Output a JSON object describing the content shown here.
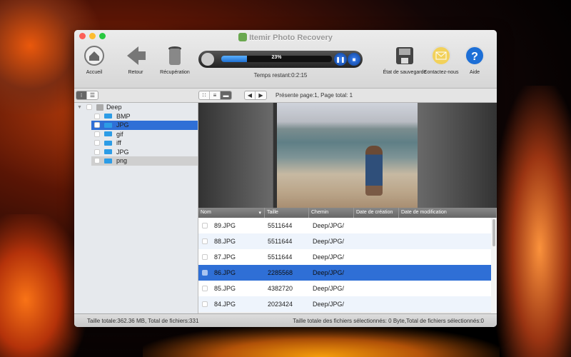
{
  "app": {
    "title": "Itemir Photo Recovery"
  },
  "toolbar": {
    "home": "Accueil",
    "back": "Retour",
    "recover": "Récupération",
    "save_state": "État de sauvegarde",
    "contact": "Contactez-nous",
    "help": "Aide"
  },
  "progress": {
    "percent_label": "23%",
    "percent": 23,
    "time_remaining": "Temps restant:0:2:15"
  },
  "pager": {
    "text": "Présente page:1,  Page total: 1"
  },
  "tree": {
    "root": "Deep",
    "items": [
      {
        "label": "BMP"
      },
      {
        "label": "JPG",
        "selected": true
      },
      {
        "label": "gif"
      },
      {
        "label": "iff"
      },
      {
        "label": "JPG"
      },
      {
        "label": "png"
      }
    ]
  },
  "table": {
    "columns": [
      "Nom",
      "Taille",
      "Chemin",
      "Date de création",
      "Date de modification"
    ],
    "rows": [
      {
        "name": "89.JPG",
        "size": "5511644",
        "path": "Deep/JPG/"
      },
      {
        "name": "88.JPG",
        "size": "5511644",
        "path": "Deep/JPG/"
      },
      {
        "name": "87.JPG",
        "size": "5511644",
        "path": "Deep/JPG/"
      },
      {
        "name": "86.JPG",
        "size": "2285568",
        "path": "Deep/JPG/",
        "selected": true
      },
      {
        "name": "85.JPG",
        "size": "4382720",
        "path": "Deep/JPG/"
      },
      {
        "name": "84.JPG",
        "size": "2023424",
        "path": "Deep/JPG/"
      }
    ]
  },
  "status": {
    "left": "Taille totale:362.36 MB,   Total de fichiers:331",
    "right": "Taille totale des fichiers sélectionnés:  0 Byte,Total de fichiers sélectionnés:0"
  }
}
